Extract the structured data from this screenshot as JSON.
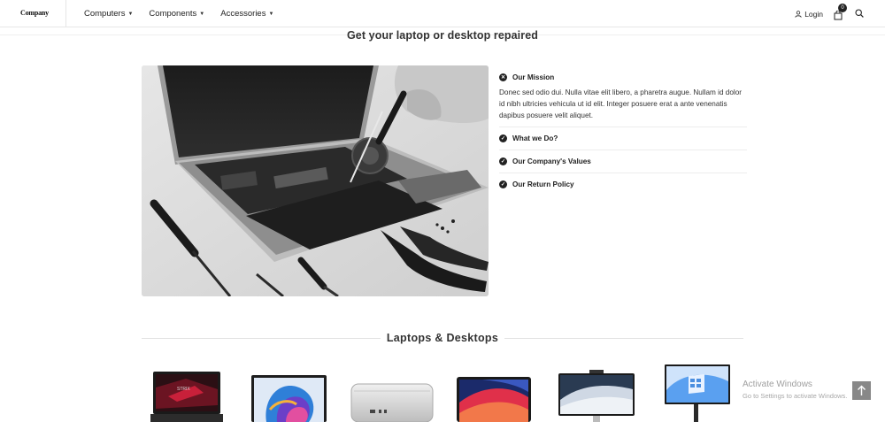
{
  "header": {
    "logo": "Company",
    "nav": [
      {
        "label": "Computers"
      },
      {
        "label": "Components"
      },
      {
        "label": "Accessories"
      }
    ],
    "login_label": "Login",
    "cart_count": "0"
  },
  "about": {
    "title": "Get your laptop or desktop repaired",
    "accordion": [
      {
        "title": "Our Mission",
        "body": "Donec sed odio dui. Nulla vitae elit libero, a pharetra augue. Nullam id dolor id nibh ultricies vehicula ut id elit. Integer posuere erat a ante venenatis dapibus posuere velit aliquet.",
        "open": true
      },
      {
        "title": "What we Do?",
        "open": false
      },
      {
        "title": "Our Company's Values",
        "open": false
      },
      {
        "title": "Our Return Policy",
        "open": false
      }
    ]
  },
  "products_section": {
    "title": "Laptops & Desktops"
  },
  "watermark": {
    "line1": "Activate Windows",
    "line2": "Go to Settings to activate Windows."
  },
  "colors": {
    "text": "#222222",
    "accent": "#222222",
    "background": "#ffffff"
  }
}
